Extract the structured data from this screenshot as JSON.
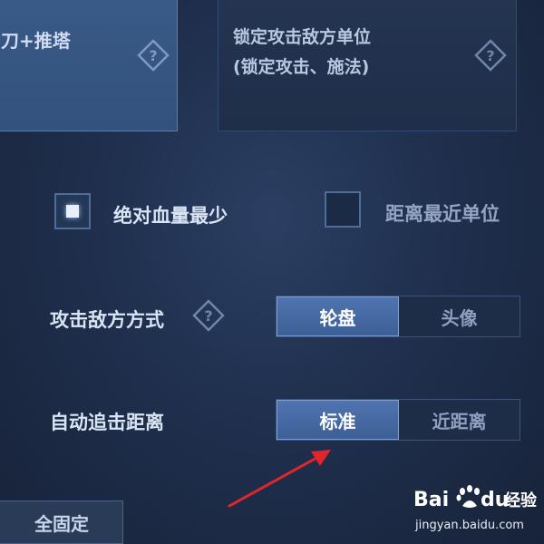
{
  "cards": {
    "left_title": "刀+推塔",
    "right_title_line1": "锁定攻击敌方单位",
    "right_title_line2": "(锁定攻击、施法)"
  },
  "target_priority": {
    "option1_label": "绝对血量最少",
    "option1_checked": true,
    "option2_label": "距离最近单位",
    "option2_checked": false
  },
  "attack_mode": {
    "label": "攻击敌方方式",
    "options": [
      "轮盘",
      "头像"
    ],
    "selected": "轮盘"
  },
  "chase_distance": {
    "label": "自动追击距离",
    "options": [
      "标准",
      "近距离"
    ],
    "selected": "标准"
  },
  "bottom_button": {
    "label": "全固定"
  },
  "watermark": {
    "brand_a": "Bai",
    "brand_b": "du",
    "brand_cn": "经验",
    "site": "jingyan.baidu.com"
  },
  "colors": {
    "accent_blue": "#4f74b0",
    "annotation_red": "#e0262b",
    "background": "#1f2f4d"
  },
  "icons": {
    "help": "question-diamond-icon",
    "annotation": "red-arrow-icon",
    "brand": "baidu-paw-icon"
  }
}
